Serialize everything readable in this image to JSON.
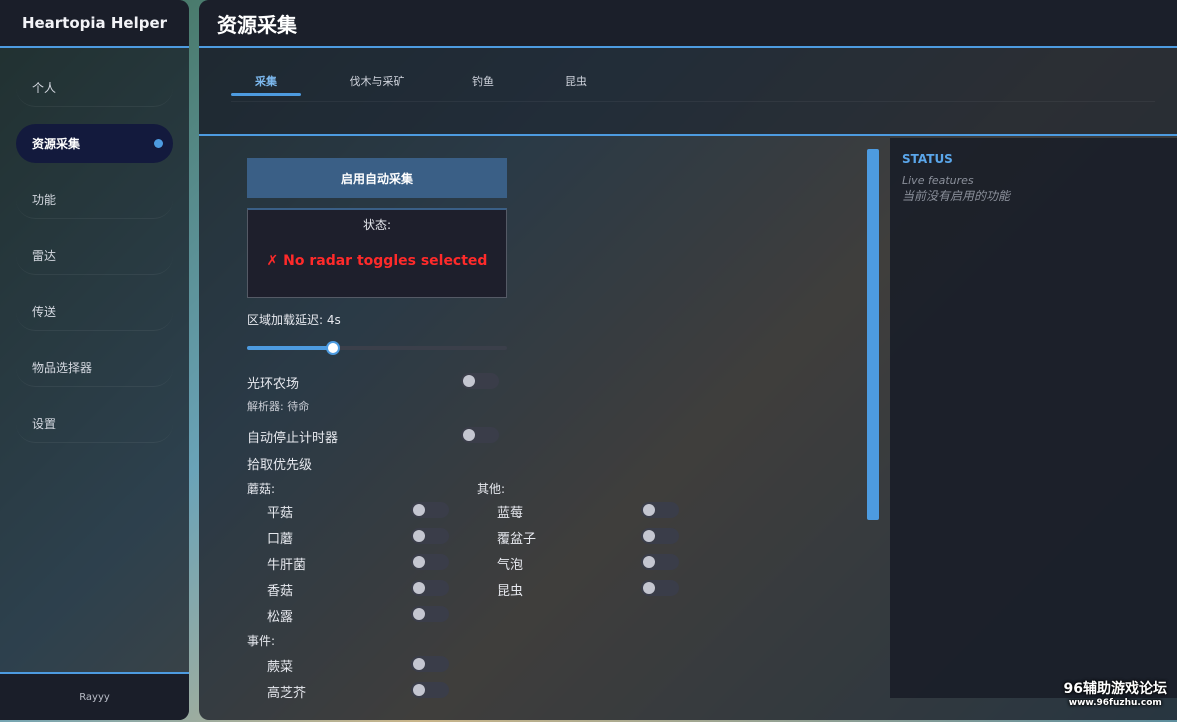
{
  "sidebar": {
    "brand": "Heartopia Helper",
    "items": [
      {
        "label": "个人"
      },
      {
        "label": "资源采集",
        "active": true
      },
      {
        "label": "功能"
      },
      {
        "label": "雷达"
      },
      {
        "label": "传送"
      },
      {
        "label": "物品选择器"
      },
      {
        "label": "设置"
      }
    ],
    "footer": "Rayyy"
  },
  "header": {
    "title": "资源采集"
  },
  "tabs": [
    {
      "label": "采集",
      "active": true
    },
    {
      "label": "伐木与采矿"
    },
    {
      "label": "钓鱼"
    },
    {
      "label": "昆虫"
    }
  ],
  "gather": {
    "start_button": "启用自动采集",
    "status_label": "状态:",
    "status_error": "✗ No radar toggles selected",
    "delay_label": "区域加载延迟: 4s",
    "delay_value": 4,
    "delay_fraction": 0.33,
    "farm_label": "光环农场",
    "parser_label": "解析器: 待命",
    "auto_stop_label": "自动停止计时器",
    "priority_label": "拾取优先级",
    "mushroom_header": "蘑菇:",
    "mushrooms": [
      "平菇",
      "口蘑",
      "牛肝菌",
      "香菇",
      "松露"
    ],
    "other_header": "其他:",
    "others": [
      "蓝莓",
      "覆盆子",
      "气泡",
      "昆虫"
    ],
    "event_header": "事件:",
    "events": [
      "蕨菜",
      "高芝芥"
    ]
  },
  "status_panel": {
    "title": "STATUS",
    "subtitle": "Live features",
    "empty_text": "当前没有启用的功能"
  },
  "watermark": {
    "line1": "96辅助游戏论坛",
    "line2": "www.96fuzhu.com"
  },
  "colors": {
    "accent": "#4d9be0",
    "error": "#ff2a2a",
    "button": "#3a5f86"
  }
}
